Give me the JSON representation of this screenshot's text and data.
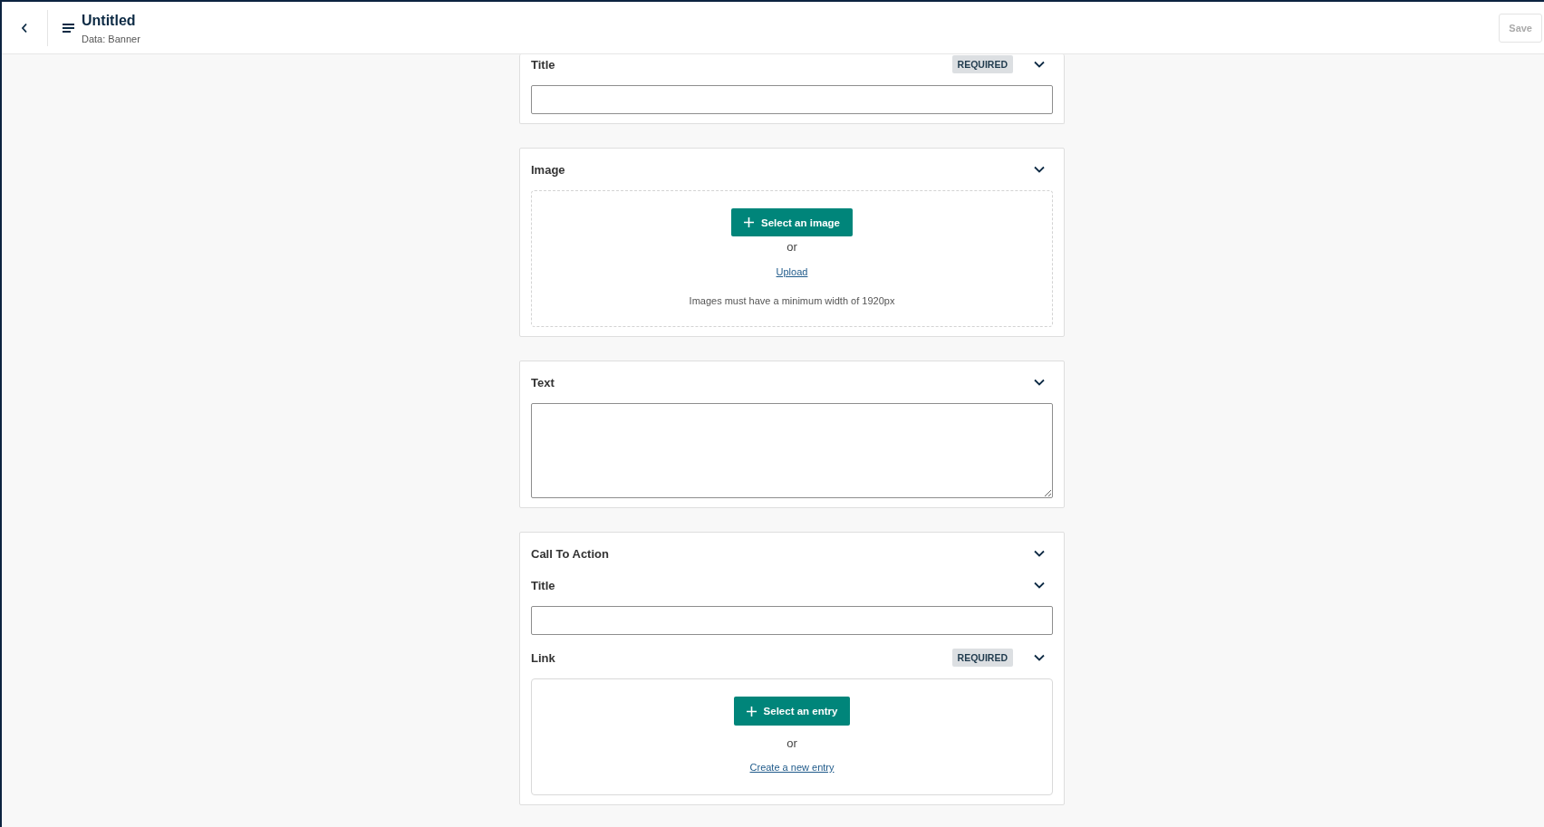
{
  "header": {
    "title": "Untitled",
    "subtitle": "Data: Banner",
    "save_button": {
      "label": "Save",
      "disabled": true
    }
  },
  "fields": [
    {
      "kind": "text",
      "label": "Title",
      "badge": "REQUIRED",
      "expanded": true
    },
    {
      "kind": "image",
      "label": "Image",
      "expanded": true,
      "button": "Select an image",
      "separator": "or",
      "link": "Upload",
      "hint": "Images must have a minimum width of 1920px"
    },
    {
      "kind": "textarea",
      "label": "Text",
      "expanded": true
    },
    {
      "kind": "group",
      "label": "Call To Action",
      "expanded": true,
      "children": [
        {
          "kind": "text",
          "label": "Title",
          "expanded": true
        },
        {
          "kind": "entry",
          "label": "Link",
          "badge": "REQUIRED",
          "expanded": true,
          "button": "Select an entry",
          "separator": "or",
          "link": "Create a new entry"
        }
      ]
    }
  ]
}
